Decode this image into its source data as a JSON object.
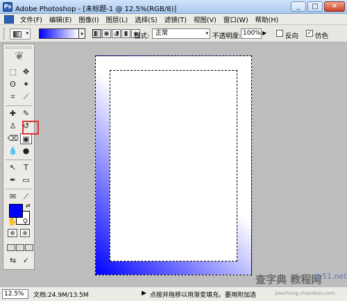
{
  "window": {
    "title": "Adobe Photoshop - [未标题-1 @ 12.5%(RGB/8)]",
    "app_icon": "ps-app-icon",
    "buttons": {
      "minimize": "_",
      "maximize": "□",
      "close": "✕"
    }
  },
  "menu": {
    "items": [
      "文件(F)",
      "编辑(E)",
      "图像(I)",
      "图层(L)",
      "选择(S)",
      "滤镜(T)",
      "视图(V)",
      "窗口(W)",
      "帮助(H)"
    ]
  },
  "options": {
    "gradient_colors": [
      "#0000ff",
      "#ffffff"
    ],
    "gradient_types": [
      "linear",
      "radial",
      "angle",
      "reflected",
      "diamond"
    ],
    "selected_gradient_type": "linear",
    "mode_label": "模式:",
    "mode_value": "正常",
    "opacity_label": "不透明度:",
    "opacity_value": "100%",
    "reverse_label": "反向",
    "reverse_checked": false,
    "dither_label": "仿色",
    "dither_checked": true,
    "dither_mark": "✓"
  },
  "toolbox": {
    "active_tool": "gradient-tool",
    "highlight_color": "#e03030",
    "foreground_color": "#0000ff",
    "background_color": "#ffffff",
    "tool_glyphs": {
      "marquee": "⬚",
      "move": "✥",
      "lasso": "ʘ",
      "magic_wand": "✦",
      "crop": "⌗",
      "slice": "⟋",
      "healing": "✚",
      "brush": "✎",
      "stamp": "♙",
      "history_brush": "↺",
      "eraser": "⌫",
      "gradient": "▣",
      "blur": "💧",
      "dodge": "●",
      "path_select": "↖",
      "type": "T",
      "pen": "✒",
      "shape": "▭",
      "notes": "✉",
      "eyedropper": "⟋",
      "hand": "✋",
      "zoom": "⚲"
    }
  },
  "canvas": {
    "gradient_from": "#0000ff",
    "gradient_to": "#ffffff"
  },
  "status": {
    "zoom": "12.5%",
    "doc_info": "文档:24.9M/13.5M",
    "arrow": "▶",
    "hint": "点按并拖移以用渐变填充。要用附加选"
  },
  "watermark": {
    "text_cn": "查字典 教程网",
    "site": "jb51.net",
    "url": "jiaocheng.chazidian.com"
  }
}
